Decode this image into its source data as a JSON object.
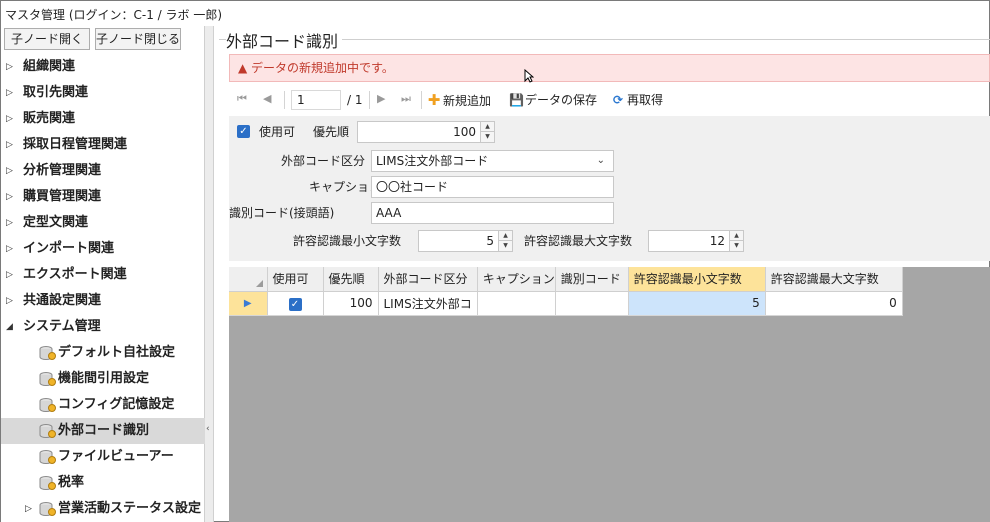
{
  "window": {
    "title": "マスタ管理 (ログイン：C-1 / ラボ 一郎)"
  },
  "toolbar": {
    "expand_label": "子ノード開く",
    "collapse_label": "子ノード閉じる"
  },
  "tree": {
    "items": [
      {
        "label": "組織関連"
      },
      {
        "label": "取引先関連"
      },
      {
        "label": "販売関連"
      },
      {
        "label": "採取日程管理関連"
      },
      {
        "label": "分析管理関連"
      },
      {
        "label": "購買管理関連"
      },
      {
        "label": "定型文関連"
      },
      {
        "label": "インポート関連"
      },
      {
        "label": "エクスポート関連"
      },
      {
        "label": "共通設定関連"
      },
      {
        "label": "システム管理"
      }
    ],
    "children": [
      {
        "label": "デフォルト自社設定"
      },
      {
        "label": "機能間引用設定"
      },
      {
        "label": "コンフィグ記憶設定"
      },
      {
        "label": "外部コード識別"
      },
      {
        "label": "ファイルビューアー"
      },
      {
        "label": "税率"
      },
      {
        "label": "営業活動ステータス設定"
      }
    ]
  },
  "panel": {
    "title": "外部コード識別",
    "alert": "▲ データの新規追加中です。"
  },
  "navigator": {
    "page": "1",
    "total": "/ 1",
    "add_label": "新規追加",
    "save_label": "データの保存",
    "reload_label": "再取得"
  },
  "form": {
    "enabled_label": "使用可",
    "priority_label": "優先順",
    "priority_value": "100",
    "category_label": "外部コード区分",
    "category_value": "LIMS注文外部コード",
    "caption_label": "キャプション",
    "caption_value": "〇〇社コード",
    "prefix_label": "識別コード(接頭語)",
    "prefix_value": "AAA",
    "min_label": "許容認識最小文字数",
    "min_value": "5",
    "max_label": "許容認識最大文字数",
    "max_value": "12"
  },
  "grid": {
    "columns": [
      "使用可",
      "優先順",
      "外部コード区分",
      "キャプション",
      "識別コード",
      "許容認識最小文字数",
      "許容認識最大文字数"
    ],
    "rows": [
      {
        "enabled": "✓",
        "priority": "100",
        "category": "LIMS注文外部コ",
        "caption": "",
        "prefix": "",
        "min": "5",
        "max": "0"
      }
    ]
  }
}
